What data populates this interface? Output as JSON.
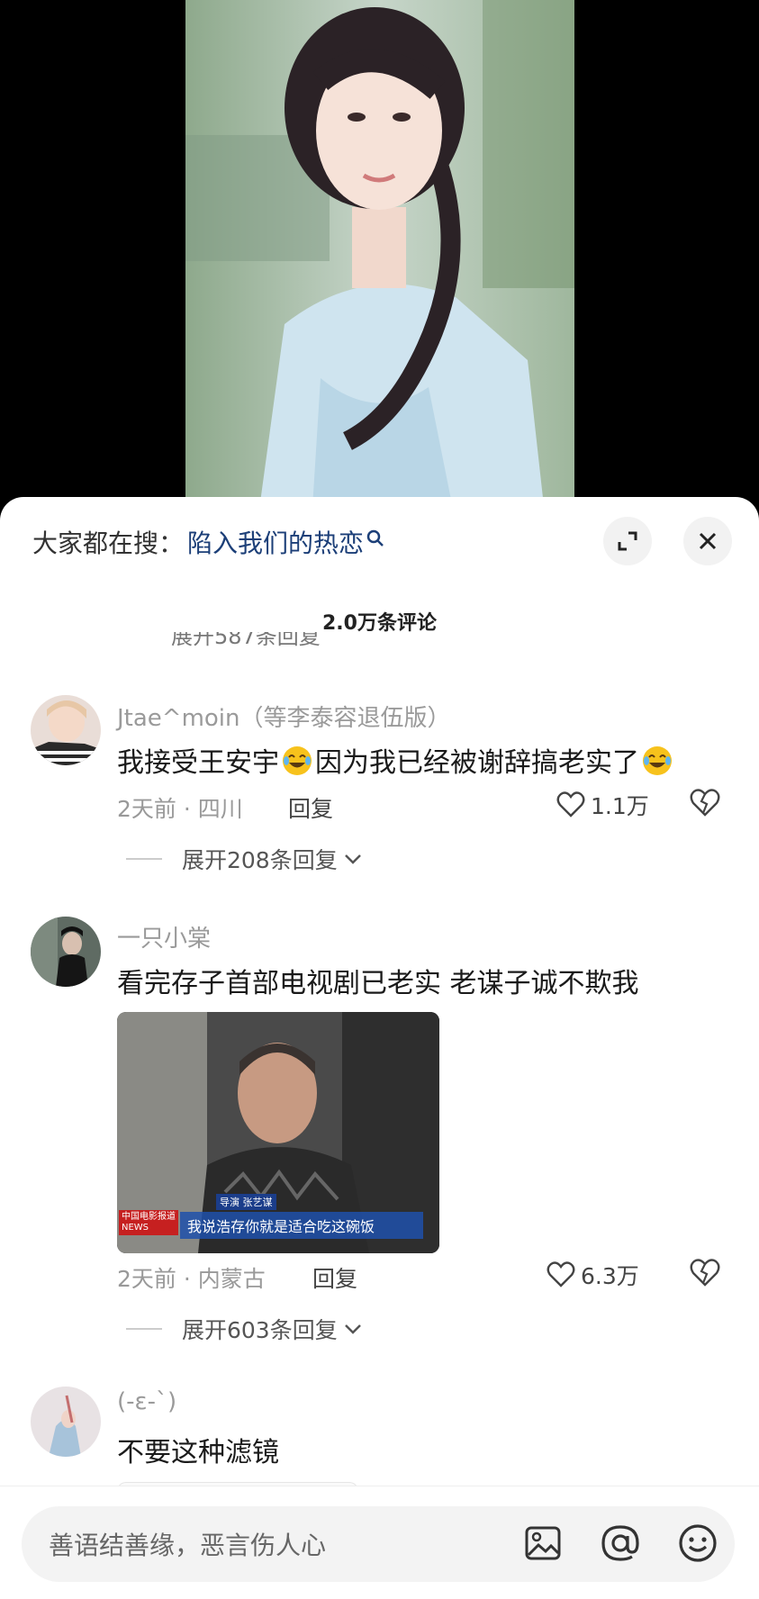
{
  "sheet": {
    "search_prefix": "大家都在搜：",
    "search_term": "陷入我们的热恋",
    "comment_count": "2.0万条评论",
    "prev_expand_partial": "展开587条回复"
  },
  "comments": [
    {
      "user": "Jtae^moin（等李泰容退伍版）",
      "text_a": "我接受王安宇",
      "text_b": "因为我已经被谢辞搞老实了",
      "time_location": "2天前 · 四川",
      "reply_label": "回复",
      "likes": "1.1万",
      "expand_label": "展开208条回复"
    },
    {
      "user": "一只小棠",
      "text": "看完存子首部电视剧已老实 老谋子诚不欺我",
      "image_caption_name": "导演 张艺谋",
      "image_subtitle": "我说浩存你就是适合吃这碗饭",
      "image_logo": "中国电影报道 NEWS",
      "time_location": "2天前 · 内蒙古",
      "reply_label": "回复",
      "likes": "6.3万",
      "expand_label": "展开603条回复"
    },
    {
      "user": "(-ε-`)",
      "text": "不要这种滤镜"
    }
  ],
  "input": {
    "placeholder": "善语结善缘，恶言伤人心"
  },
  "icons": [
    "search-icon",
    "expand-icon",
    "close-icon",
    "heart-icon",
    "broken-heart-icon",
    "chevron-down-icon",
    "image-icon",
    "at-icon",
    "emoji-icon",
    "laugh-cry-emoji"
  ]
}
